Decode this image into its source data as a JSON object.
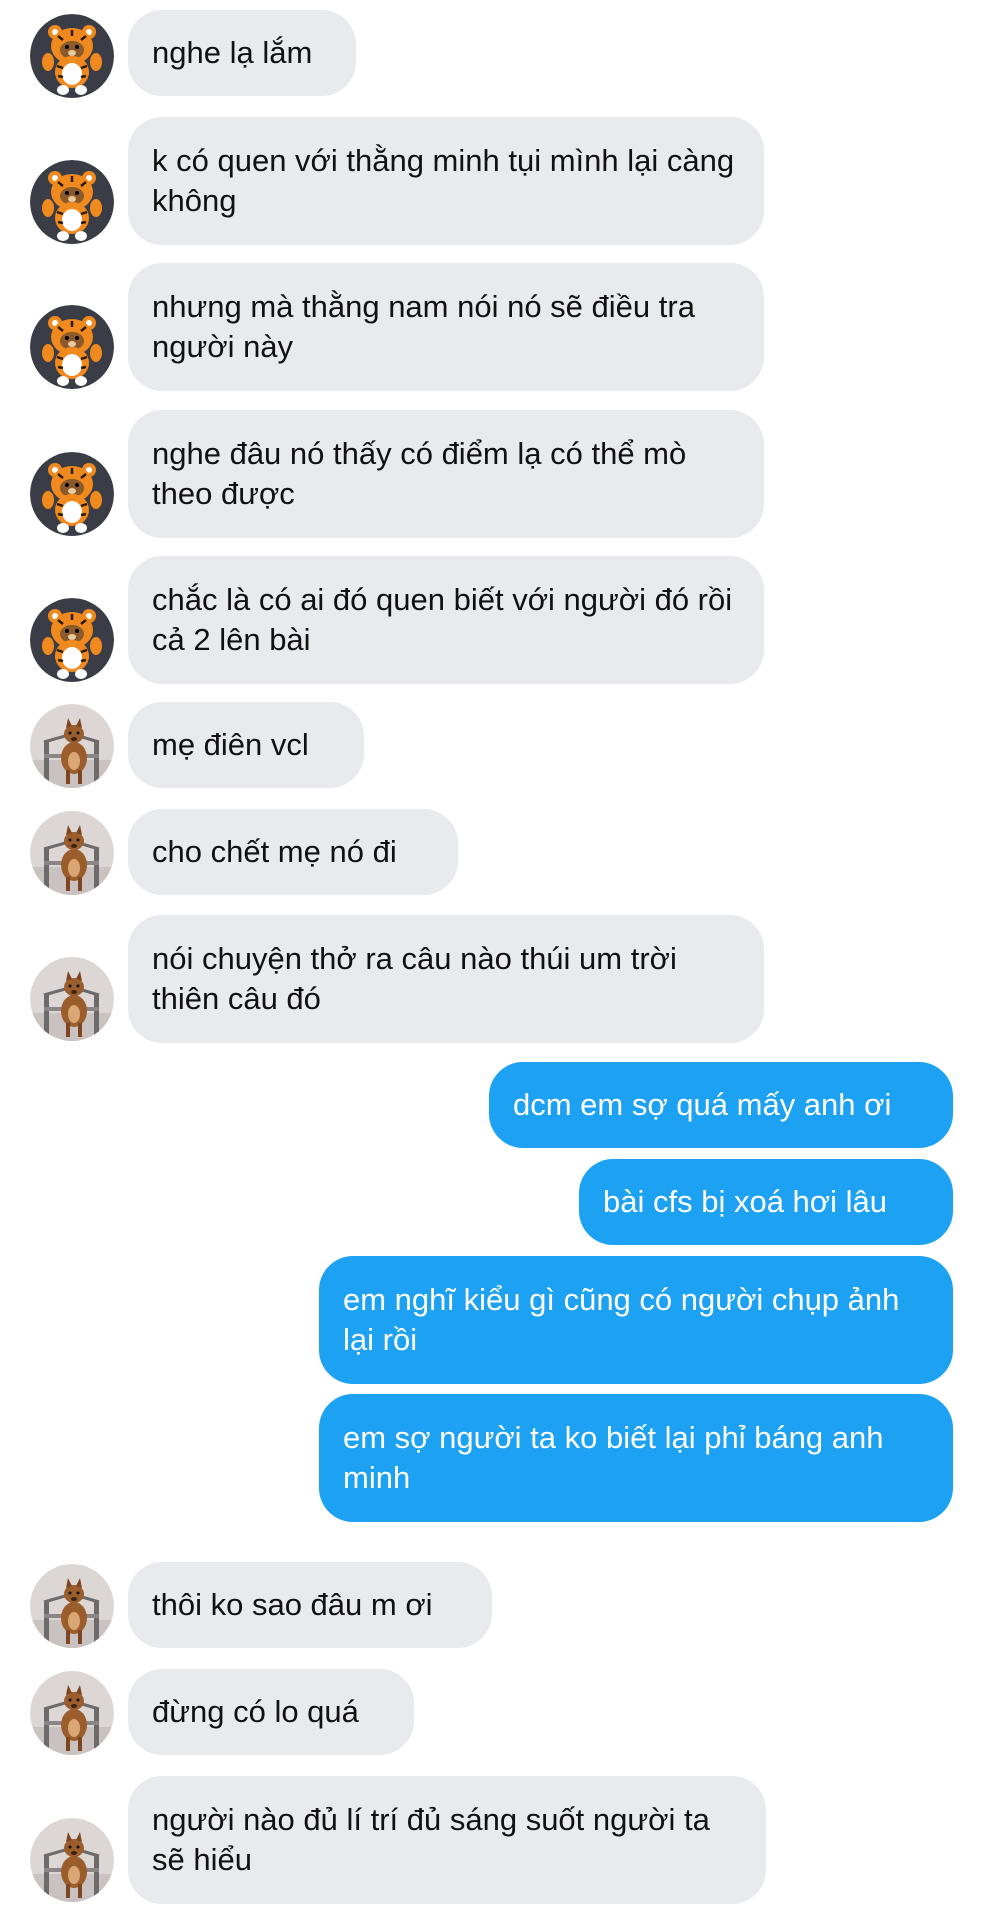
{
  "conversation": {
    "messages": [
      {
        "sender": "tiger",
        "text": "nghe lạ lắm"
      },
      {
        "sender": "tiger",
        "text": "k có quen với thằng minh tụi mình lại càng không"
      },
      {
        "sender": "tiger",
        "text": "nhưng mà thằng nam nói nó sẽ điều tra người này"
      },
      {
        "sender": "tiger",
        "text": "nghe đâu nó thấy có điểm lạ có thể mò theo được"
      },
      {
        "sender": "tiger",
        "text": "chắc là có ai đó quen biết với người đó rồi cả 2 lên bài"
      },
      {
        "sender": "fox",
        "text": "mẹ điên vcl"
      },
      {
        "sender": "fox",
        "text": "cho chết mẹ nó đi"
      },
      {
        "sender": "fox",
        "text": "nói chuyện thở ra câu nào thúi um trời thiên câu đó"
      },
      {
        "sender": "me",
        "text": "dcm em sợ quá mấy anh ơi"
      },
      {
        "sender": "me",
        "text": "bài cfs bị xoá hơi lâu"
      },
      {
        "sender": "me",
        "text": "em nghĩ kiểu gì cũng có người chụp ảnh lại rồi"
      },
      {
        "sender": "me",
        "text": "em sợ người ta ko biết lại phỉ báng anh minh"
      },
      {
        "sender": "fox",
        "text": "thôi ko sao đâu m ơi"
      },
      {
        "sender": "fox",
        "text": "đừng có lo quá"
      },
      {
        "sender": "fox",
        "text": "người nào đủ lí trí đủ sáng suốt người ta sẽ hiểu"
      }
    ]
  },
  "colors": {
    "incoming_bubble": "#e9eaee",
    "outgoing_bubble": "#1da1f2",
    "outgoing_text": "#ffffff",
    "incoming_text": "#111111"
  },
  "icons": {
    "tiger": "tiger-avatar-icon",
    "fox": "fox-avatar-icon"
  }
}
